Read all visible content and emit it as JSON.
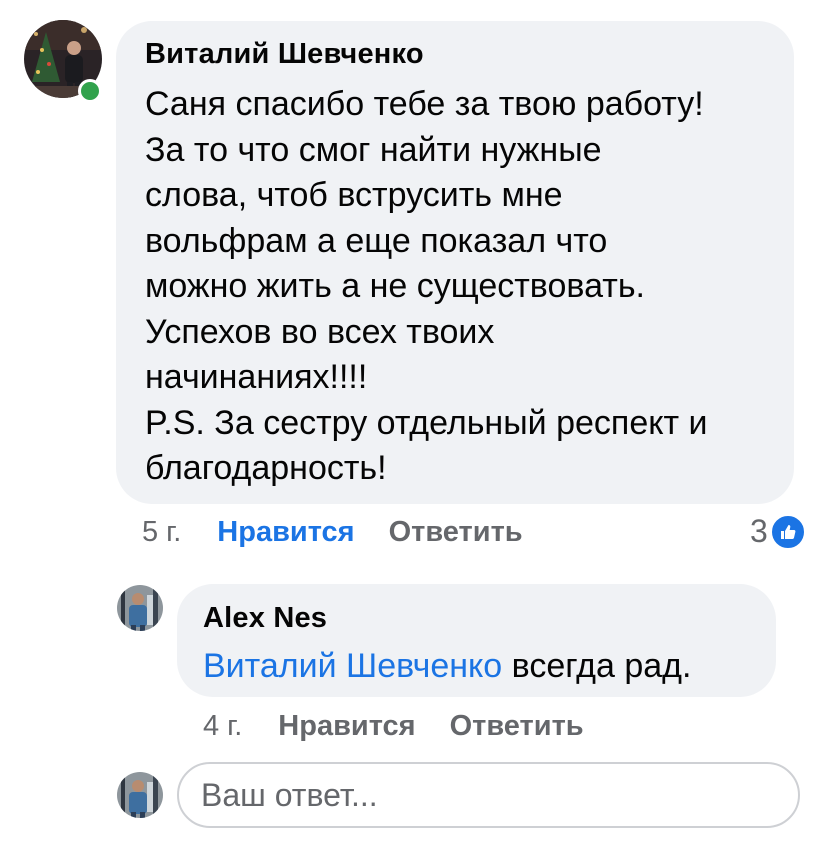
{
  "comment": {
    "author": "Виталий Шевченко",
    "text_lines": [
      "Саня спасибо тебе за твою работу!",
      "За то что смог найти нужные",
      "слова, чтоб вструсить мне",
      "вольфрам а еще показал что",
      "можно жить а не существовать.",
      "Успехов во всех твоих",
      "начинаниях!!!!",
      "P.S. За сестру отдельный респект и",
      "благодарность!"
    ],
    "time": "5 г.",
    "like_label": "Нравится",
    "reply_label": "Ответить",
    "reaction_count": "3",
    "reaction_icon": "thumbs-up-icon",
    "online": true,
    "colors": {
      "like_active": "#1b74e4",
      "online": "#31a24c"
    }
  },
  "reply": {
    "author": "Alex Nes",
    "mention": "Виталий Шевченко",
    "text": " всегда рад.",
    "time": "4 г.",
    "like_label": "Нравится",
    "reply_label": "Ответить"
  },
  "composer": {
    "placeholder": "Ваш ответ..."
  }
}
